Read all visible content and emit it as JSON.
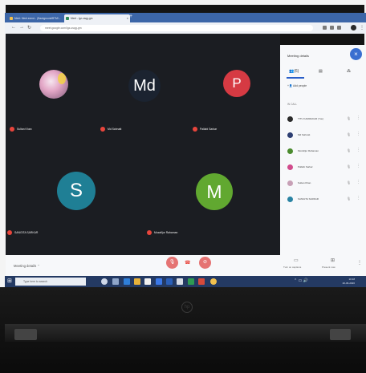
{
  "browser": {
    "tabs": [
      {
        "label": "Meet: Meet.ezmd... (Background/BTM/..."
      },
      {
        "label": "Meet - lgz-usqg-gm"
      }
    ],
    "new_tab": "+",
    "url": "meet.google.com/lgz-usqg-gm"
  },
  "meeting": {
    "participants": [
      {
        "name": "Sultan Khan",
        "initials": "",
        "color": "#d98ab5"
      },
      {
        "name": "Md Sahnatt",
        "initials": "Md",
        "color": "#1b2330"
      },
      {
        "name": "Pallabi Sarkar",
        "initials": "P",
        "color": "#d63a43"
      },
      {
        "name": "SANGITA SARKAR",
        "initials": "S",
        "color": "#1f7f95"
      },
      {
        "name": "Mozafijur Rahaman",
        "initials": "M",
        "color": "#61a830"
      }
    ]
  },
  "panel": {
    "title": "Meeting details",
    "close": "×",
    "tab_people_count": "(6)",
    "add_people": "Add people",
    "in_meeting": "IN CALL",
    "people": [
      {
        "name": "TITU KARMAKAR (You)",
        "color": "#2b2b2b"
      },
      {
        "name": "Md Sahnatt",
        "color": "#2d3f72"
      },
      {
        "name": "Mozafijur Rahaman",
        "color": "#4b8b2e"
      },
      {
        "name": "Pallabi Sarkar",
        "color": "#d14b8c"
      },
      {
        "name": "Sultan Khan",
        "color": "#c7a0b6"
      },
      {
        "name": "SANGITA SARKAR",
        "color": "#2a83a3"
      }
    ]
  },
  "controls": {
    "meeting_details": "Meeting details",
    "turn_on_captions": "Turn on captions",
    "present_now": "Present now"
  },
  "taskbar": {
    "search": "Type here to search",
    "time": "10:18",
    "date": "20-06-2020"
  }
}
